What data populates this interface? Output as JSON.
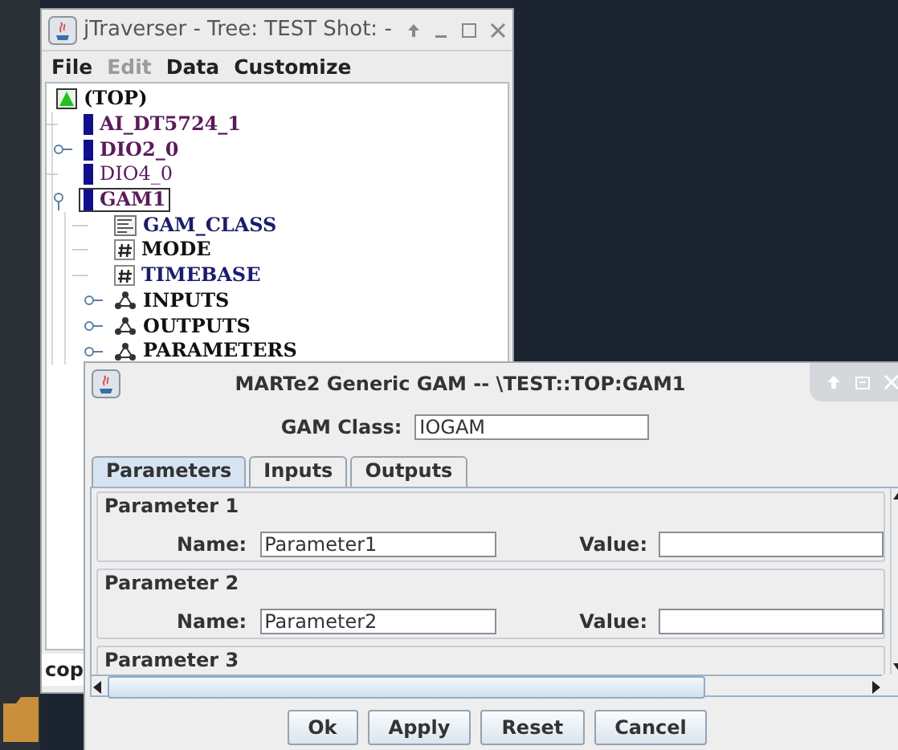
{
  "main_window": {
    "title": "jTraverser - Tree: TEST Shot: -",
    "menu": [
      {
        "label": "File",
        "disabled": false
      },
      {
        "label": "Edit",
        "disabled": true
      },
      {
        "label": "Data",
        "disabled": false
      },
      {
        "label": "Customize",
        "disabled": false
      }
    ],
    "tree": {
      "label": "(TOP)",
      "kind": "top",
      "color": "#111111",
      "on": true,
      "selected": false,
      "children": [
        {
          "label": "AI_DT5724_1",
          "kind": "device",
          "color": "#5b1b5b",
          "on": true,
          "selected": false
        },
        {
          "label": "DIO2_0",
          "kind": "device",
          "color": "#5b1b5b",
          "on": true,
          "selected": false,
          "expanded": false
        },
        {
          "label": "DIO4_0",
          "kind": "device",
          "color": "#5b1b5b",
          "on": false,
          "selected": false
        },
        {
          "label": "GAM1",
          "kind": "device",
          "color": "#5b1b5b",
          "on": true,
          "selected": true,
          "expanded": true,
          "children": [
            {
              "label": "GAM_CLASS",
              "kind": "text",
              "color": "#1c1c6b",
              "on": true,
              "selected": false
            },
            {
              "label": "MODE",
              "kind": "numeric",
              "color": "#111111",
              "on": true,
              "selected": false
            },
            {
              "label": "TIMEBASE",
              "kind": "numeric",
              "color": "#1c1c6b",
              "on": true,
              "selected": false
            },
            {
              "label": "INPUTS",
              "kind": "structure",
              "color": "#111111",
              "on": true,
              "selected": false,
              "expanded": false
            },
            {
              "label": "OUTPUTS",
              "kind": "structure",
              "color": "#111111",
              "on": true,
              "selected": false,
              "expanded": false
            },
            {
              "label": "PARAMETERS",
              "kind": "structure",
              "color": "#111111",
              "on": true,
              "selected": false,
              "expanded": false
            }
          ]
        }
      ]
    },
    "status_text": "cop"
  },
  "dialog": {
    "title": "MARTe2 Generic GAM -- \\TEST::TOP:GAM1",
    "gam_class_label": "GAM Class:",
    "gam_class": "IOGAM",
    "tabs": [
      {
        "label": "Parameters",
        "selected": true
      },
      {
        "label": "Inputs",
        "selected": false
      },
      {
        "label": "Outputs",
        "selected": false
      }
    ],
    "parameters": [
      {
        "title": "Parameter 1",
        "name_label": "Name:",
        "name": "Parameter1",
        "value_label": "Value:"
      },
      {
        "title": "Parameter 2",
        "name_label": "Name:",
        "name": "Parameter2",
        "value_label": "Value:"
      },
      {
        "title": "Parameter 3"
      }
    ],
    "buttons": [
      "Ok",
      "Apply",
      "Reset",
      "Cancel"
    ]
  }
}
